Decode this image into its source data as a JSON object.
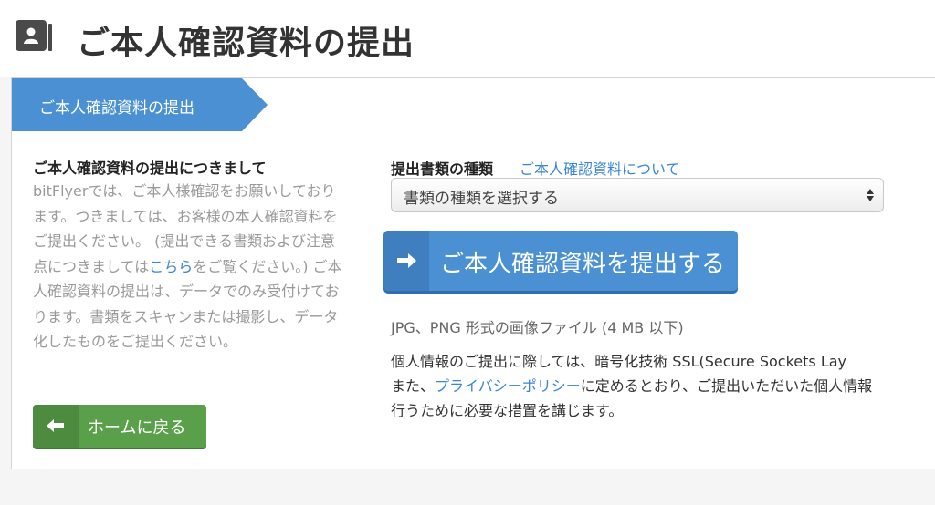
{
  "page": {
    "title": "ご本人確認資料の提出",
    "title_icon": "contact-book-icon"
  },
  "step": {
    "label": "ご本人確認資料の提出"
  },
  "left": {
    "heading": "ご本人確認資料の提出につきまして",
    "text_before_link": "bitFlyerでは、ご本人様確認をお願いしております。つきましては、お客様の本人確認資料をご提出ください。 (提出できる書類および注意点につきましては",
    "link_text": "こちら",
    "text_after_link": "をご覧ください。) ご本人確認資料の提出は、データでのみ受付けております。書類をスキャンまたは撮影し、データ化したものをご提出ください。",
    "home_button": "ホームに戻る",
    "home_icon": "arrow-left-icon"
  },
  "form": {
    "doc_type_label": "提出書類の種類",
    "doc_type_link": "ご本人確認資料について",
    "select_value": "書類の種類を選択する",
    "submit_button": "ご本人確認資料を提出する",
    "submit_icon": "arrow-right-icon",
    "file_note": "JPG、PNG 形式の画像ファイル (4 MB 以下)"
  },
  "privacy": {
    "line1": "個人情報のご提出に際しては、暗号化技術 SSL(Secure Sockets Lay",
    "line2_before": "また、",
    "line2_link": "プライバシーポリシー",
    "line2_after": "に定めるとおり、ご提出いただいた個人情報",
    "line3": "行うために必要な措置を講じます。"
  },
  "colors": {
    "accent_blue": "#4a90d2",
    "link_blue": "#3a86d4",
    "home_green": "#5aa04a"
  }
}
